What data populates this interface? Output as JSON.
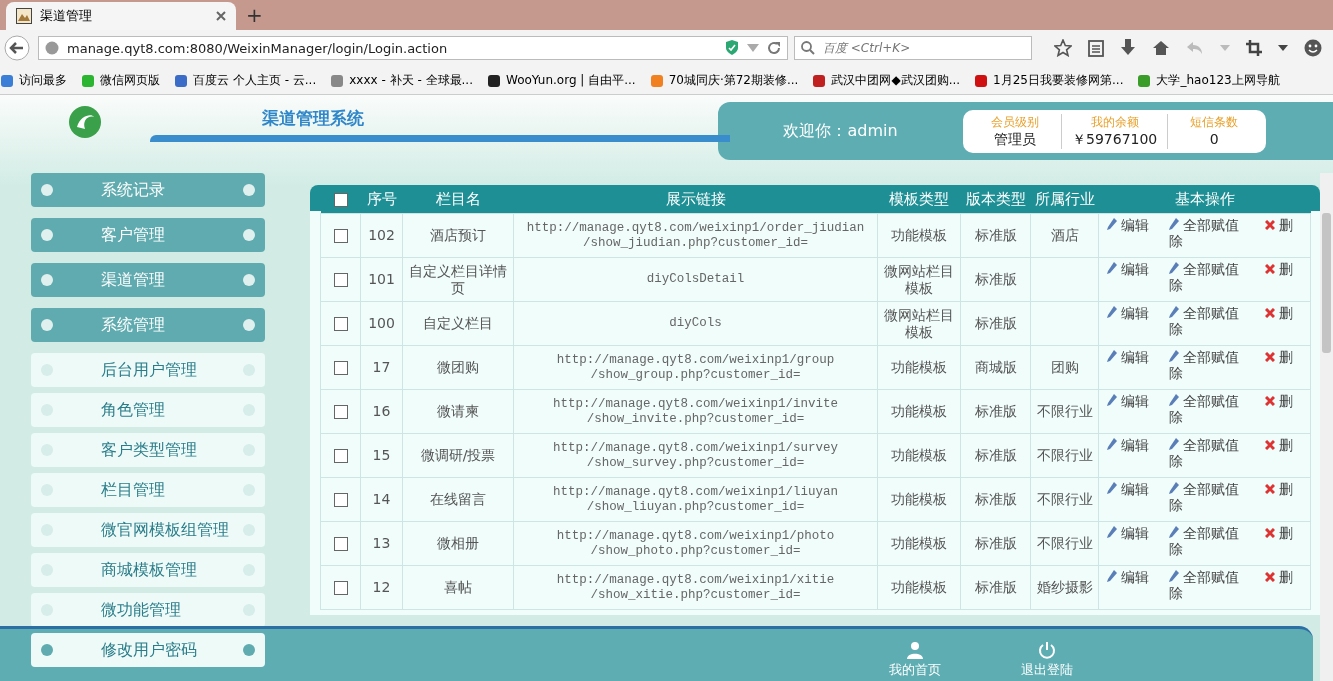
{
  "browser": {
    "tab_title": "渠道管理",
    "new_tab": "+",
    "url": "manage.qyt8.com:8080/WeixinManager/login/Login.action",
    "search_placeholder": "百度 <Ctrl+K>",
    "bookmarks": [
      "访问最多",
      "微信网页版",
      "百度云 个人主页 - 云...",
      "xxxx - 补天 - 全球最...",
      "WooYun.org | 自由平...",
      "70城同庆·第72期装修...",
      "武汉中团网◆武汉团购...",
      "1月25日我要装修网第...",
      "大学_hao123上网导航"
    ]
  },
  "header": {
    "system_title": "渠道管理系统",
    "welcome": "欢迎你：admin",
    "stats": [
      {
        "label": "会员级别",
        "value": "管理员"
      },
      {
        "label": "我的余额",
        "value": "￥59767100"
      },
      {
        "label": "短信条数",
        "value": "0"
      }
    ]
  },
  "sidebar": {
    "items": [
      {
        "label": "系统记录",
        "kind": "group"
      },
      {
        "label": "客户管理",
        "kind": "group"
      },
      {
        "label": "渠道管理",
        "kind": "group"
      },
      {
        "label": "系统管理",
        "kind": "group"
      },
      {
        "label": "后台用户管理",
        "kind": "sub"
      },
      {
        "label": "角色管理",
        "kind": "sub"
      },
      {
        "label": "客户类型管理",
        "kind": "sub"
      },
      {
        "label": "栏目管理",
        "kind": "sub"
      },
      {
        "label": "微官网模板组管理",
        "kind": "sub"
      },
      {
        "label": "商城模板管理",
        "kind": "sub"
      },
      {
        "label": "微功能管理",
        "kind": "sub"
      },
      {
        "label": "修改用户密码",
        "kind": "sub"
      }
    ]
  },
  "table": {
    "header_checked": false,
    "columns": [
      "序号",
      "栏目名",
      "展示链接",
      "模板类型",
      "版本类型",
      "所属行业",
      "基本操作"
    ],
    "rows": [
      {
        "checked": false,
        "no": "102",
        "name": "酒店预订",
        "link": "http://manage.qyt8.com/weixinp1/order_jiudian /show_jiudian.php?customer_id=",
        "template": "功能模板",
        "version": "标准版",
        "industry": "酒店",
        "actions": [
          "编辑",
          "全部赋值除",
          "删"
        ]
      },
      {
        "checked": false,
        "no": "101",
        "name": "自定义栏目详情页",
        "link": "diyColsDetail",
        "template": "微网站栏目模板",
        "version": "标准版",
        "industry": "",
        "actions": [
          "编辑",
          "全部赋值除",
          "删"
        ]
      },
      {
        "checked": false,
        "no": "100",
        "name": "自定义栏目",
        "link": "diyCols",
        "template": "微网站栏目模板",
        "version": "标准版",
        "industry": "",
        "actions": [
          "编辑",
          "全部赋值除",
          "删"
        ]
      },
      {
        "checked": false,
        "no": "17",
        "name": "微团购",
        "link": "http://manage.qyt8.com/weixinp1/group /show_group.php?customer_id=",
        "template": "功能模板",
        "version": "商城版",
        "industry": "团购",
        "actions": [
          "编辑",
          "全部赋值除",
          "删"
        ]
      },
      {
        "checked": false,
        "no": "16",
        "name": "微请柬",
        "link": "http://manage.qyt8.com/weixinp1/invite /show_invite.php?customer_id=",
        "template": "功能模板",
        "version": "标准版",
        "industry": "不限行业",
        "actions": [
          "编辑",
          "全部赋值除",
          "删"
        ]
      },
      {
        "checked": false,
        "no": "15",
        "name": "微调研/投票",
        "link": "http://manage.qyt8.com/weixinp1/survey /show_survey.php?customer_id=",
        "template": "功能模板",
        "version": "标准版",
        "industry": "不限行业",
        "actions": [
          "编辑",
          "全部赋值除",
          "删"
        ]
      },
      {
        "checked": false,
        "no": "14",
        "name": "在线留言",
        "link": "http://manage.qyt8.com/weixinp1/liuyan /show_liuyan.php?customer_id=",
        "template": "功能模板",
        "version": "标准版",
        "industry": "不限行业",
        "actions": [
          "编辑",
          "全部赋值除",
          "删"
        ]
      },
      {
        "checked": false,
        "no": "13",
        "name": "微相册",
        "link": "http://manage.qyt8.com/weixinp1/photo /show_photo.php?customer_id=",
        "template": "功能模板",
        "version": "标准版",
        "industry": "不限行业",
        "actions": [
          "编辑",
          "全部赋值除",
          "删"
        ]
      },
      {
        "checked": false,
        "no": "12",
        "name": "喜帖",
        "link": "http://manage.qyt8.com/weixinp1/xitie /show_xitie.php?customer_id=",
        "template": "功能模板",
        "version": "标准版",
        "industry": "婚纱摄影",
        "actions": [
          "编辑",
          "全部赋值除",
          "删"
        ]
      }
    ]
  },
  "footer": {
    "links": [
      {
        "label": "我的首页",
        "kind": "home"
      },
      {
        "label": "退出登陆",
        "kind": "logout"
      }
    ]
  }
}
